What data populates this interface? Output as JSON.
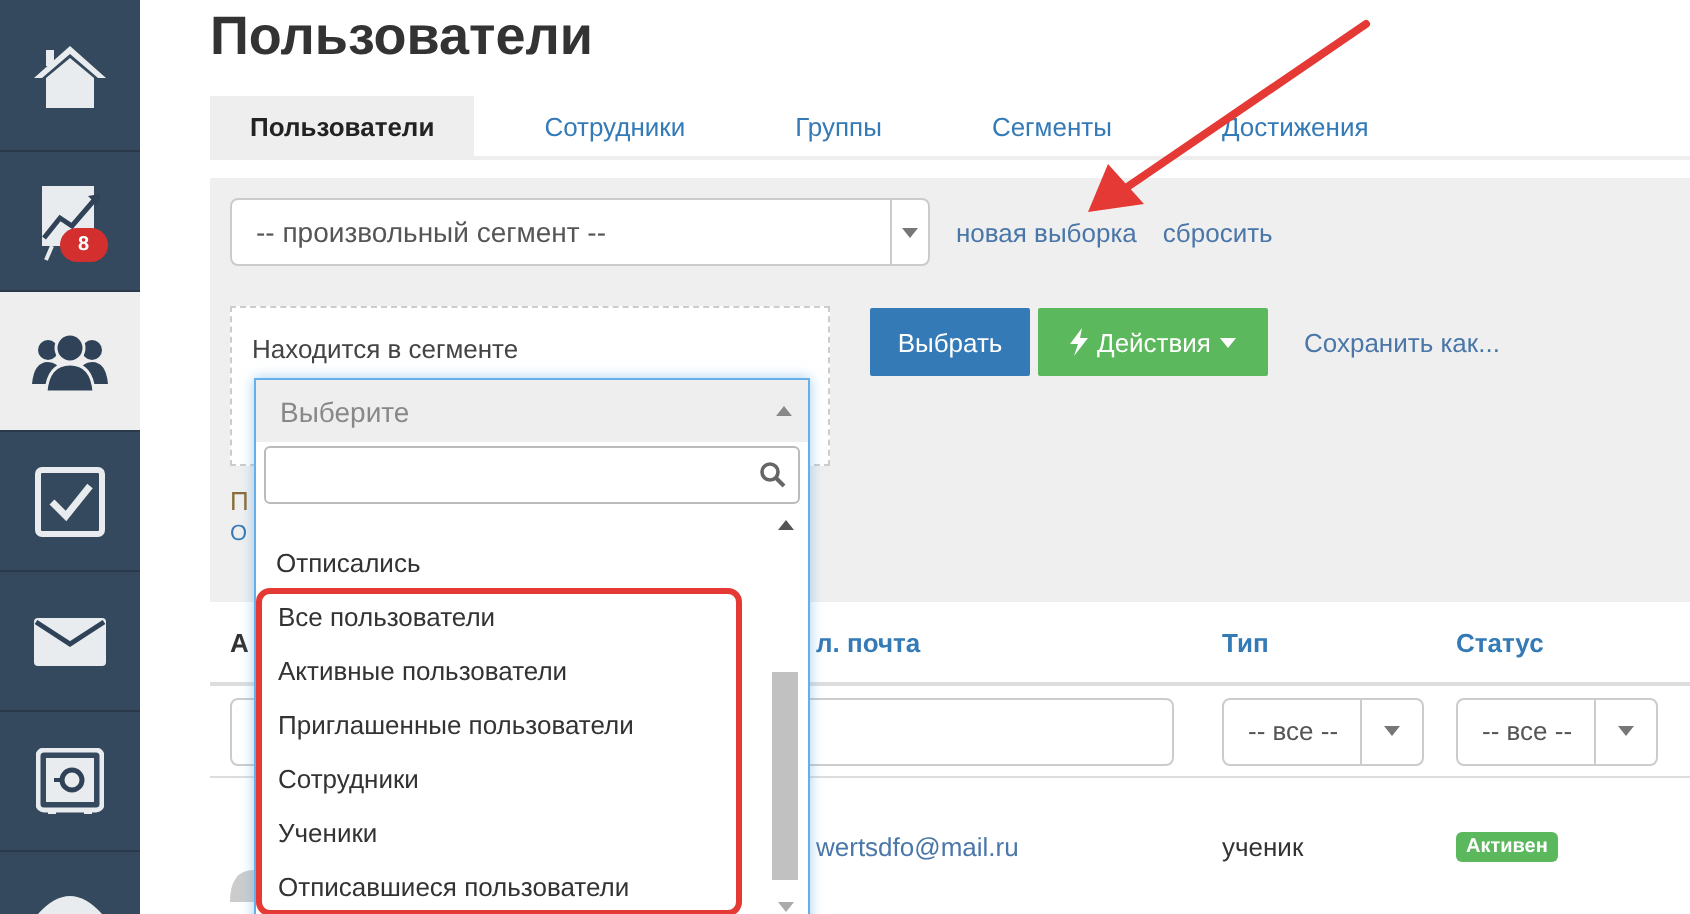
{
  "sidebar": {
    "items": [
      {
        "kind": "home",
        "selected": false
      },
      {
        "kind": "chart",
        "selected": false,
        "badge": "8"
      },
      {
        "kind": "users",
        "selected": true
      },
      {
        "kind": "tasks",
        "selected": false
      },
      {
        "kind": "mail",
        "selected": false
      },
      {
        "kind": "safe",
        "selected": false
      },
      {
        "kind": "partial",
        "selected": false
      }
    ]
  },
  "page_title": "Пользователи",
  "tabs": [
    {
      "label": "Пользователи",
      "selected": true
    },
    {
      "label": "Сотрудники",
      "selected": false
    },
    {
      "label": "Группы",
      "selected": false
    },
    {
      "label": "Сегменты",
      "selected": false
    },
    {
      "label": "Достижения",
      "selected": false
    }
  ],
  "filter_panel": {
    "segment_select": {
      "value": "-- произвольный сегмент --"
    },
    "links": [
      "новая выборка",
      "сбросить"
    ],
    "condition_label": "Находится в сегменте",
    "buttons": [
      {
        "kind": "primary",
        "label": "Выбрать"
      },
      {
        "kind": "actions",
        "label": "Действия"
      }
    ],
    "save_link": "Сохранить как...",
    "partial_label": "П",
    "partial_link": "О"
  },
  "table": {
    "columns": [
      "А",
      "л. почта",
      "Тип",
      "Статус"
    ],
    "filters": [
      {
        "kind": "input"
      },
      {
        "kind": "input"
      },
      {
        "kind": "select",
        "value": "-- все --"
      },
      {
        "kind": "select",
        "value": "-- все --"
      }
    ],
    "rows": [
      {
        "email": "wertsdfo@mail.ru",
        "type": "ученик",
        "status": "Активен"
      }
    ]
  },
  "dropdown": {
    "placeholder": "Выберите",
    "options": [
      {
        "label": "Отписались",
        "marked": false
      },
      {
        "label": "Все пользователи",
        "marked": true
      },
      {
        "label": "Активные пользователи",
        "marked": true
      },
      {
        "label": "Приглашенные пользователи",
        "marked": true
      },
      {
        "label": "Сотрудники",
        "marked": true
      },
      {
        "label": "Ученики",
        "marked": true
      },
      {
        "label": "Отписавшиеся пользователи",
        "marked": true
      }
    ]
  }
}
